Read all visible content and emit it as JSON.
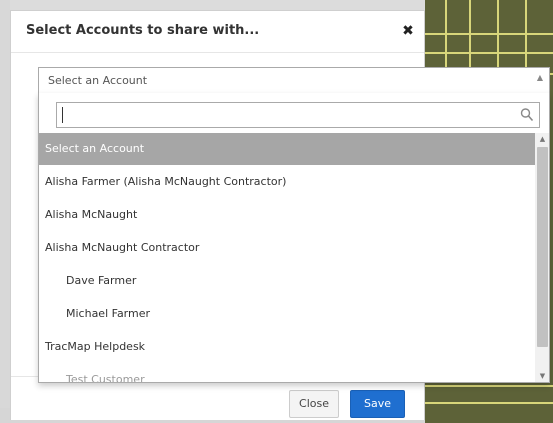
{
  "modal": {
    "title": "Select Accounts to share with...",
    "close_icon": "close-icon"
  },
  "select": {
    "placeholder": "Select an Account",
    "search_value": "",
    "options": [
      {
        "label": "Select an Account",
        "highlighted": true,
        "level": 0
      },
      {
        "label": "Alisha Farmer (Alisha McNaught Contractor)",
        "highlighted": false,
        "level": 0
      },
      {
        "label": "Alisha McNaught",
        "highlighted": false,
        "level": 0
      },
      {
        "label": "Alisha McNaught Contractor",
        "highlighted": false,
        "level": 0
      },
      {
        "label": "Dave Farmer",
        "highlighted": false,
        "level": 1
      },
      {
        "label": "Michael Farmer",
        "highlighted": false,
        "level": 1
      },
      {
        "label": "TracMap Helpdesk",
        "highlighted": false,
        "level": 0
      },
      {
        "label": "Test Customer",
        "highlighted": false,
        "level": 1
      }
    ]
  },
  "footer": {
    "close_label": "Close",
    "save_label": "Save"
  },
  "colors": {
    "save_button": "#1f6fd0",
    "highlight": "#a6a6a6",
    "map_background": "#5d6238"
  }
}
